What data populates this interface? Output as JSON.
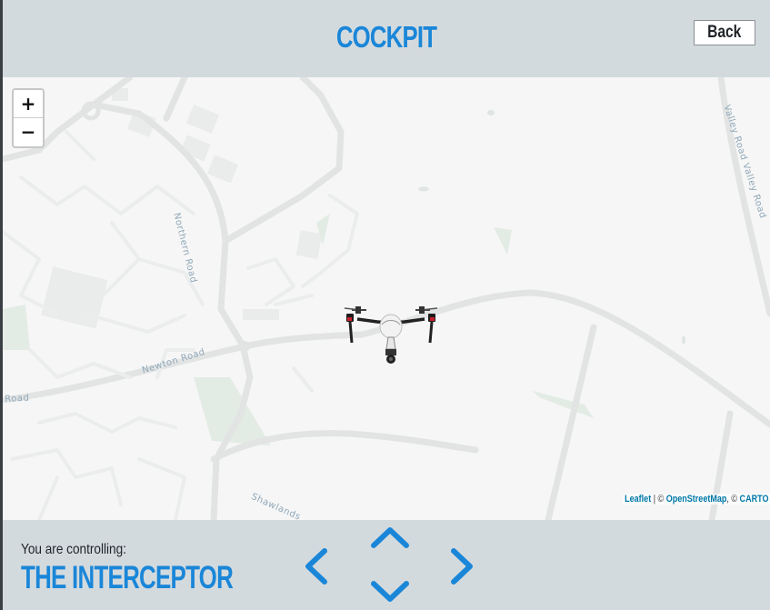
{
  "header": {
    "title": "COCKPIT",
    "back_label": "Back"
  },
  "map": {
    "zoom_in_label": "+",
    "zoom_out_label": "−",
    "road_labels": {
      "northern_road": "Northern Road",
      "newton_road": "Newton Road",
      "road_left": "Road",
      "valley_road": "Valley Road Valley Road",
      "shawlands": "Shawlands"
    },
    "attribution": {
      "leaflet": "Leaflet",
      "separator": " | © ",
      "osm": "OpenStreetMap",
      "separator2": ", © ",
      "carto": "CARTO"
    }
  },
  "footer": {
    "controlling_label": "You are controlling:",
    "drone_name": "THE INTERCEPTOR"
  },
  "controls": {
    "left_icon": "chevron-left-icon",
    "right_icon": "chevron-right-icon",
    "up_icon": "chevron-up-icon",
    "down_icon": "chevron-down-icon"
  },
  "colors": {
    "accent": "#1a86d8",
    "panel": "#d3dade",
    "map_bg": "#f6f6f6"
  }
}
